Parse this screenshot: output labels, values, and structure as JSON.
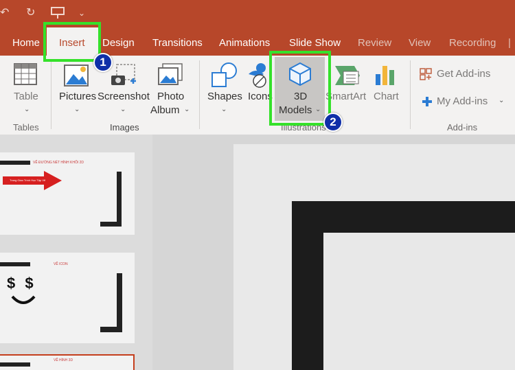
{
  "tabs": {
    "home": "Home",
    "insert": "Insert",
    "design": "Design",
    "transitions": "Transitions",
    "animations": "Animations",
    "slide_show": "Slide Show",
    "review": "Review",
    "view": "View",
    "recording": "Recording"
  },
  "ribbon": {
    "table_label": "Table",
    "tables_group": "Tables",
    "pictures_label": "Pictures",
    "screenshot_label": "Screenshot",
    "photo_album_line1": "Photo",
    "photo_album_line2": "Album",
    "images_group": "Images",
    "shapes_label": "Shapes",
    "icons_label": "Icons",
    "models_line1": "3D",
    "models_line2": "Models",
    "smartart_label": "SmartArt",
    "chart_label": "Chart",
    "illustrations_group": "Illustrations",
    "get_addins_label": "Get Add-ins",
    "my_addins_label": "My Add-ins",
    "addins_group": "Add-ins"
  },
  "annotations": {
    "step1": "1",
    "step2": "2",
    "highlight_color": "#35e12a",
    "badge_color": "#0f2fa8"
  },
  "slides": {
    "slide1_title": "VẼ ĐƯỜNG NÉT HÌNH KHỐI 2D",
    "slide1_arrow_text": "Trang Giao Trình Học Tập Vẽ",
    "slide2_title": "VẼ ICON",
    "slide2_face": "$ $",
    "slide3_title": "VẼ HÌNH 3D"
  },
  "colors": {
    "accent": "#b7472a",
    "ribbon_bg": "#f3f2f1"
  }
}
